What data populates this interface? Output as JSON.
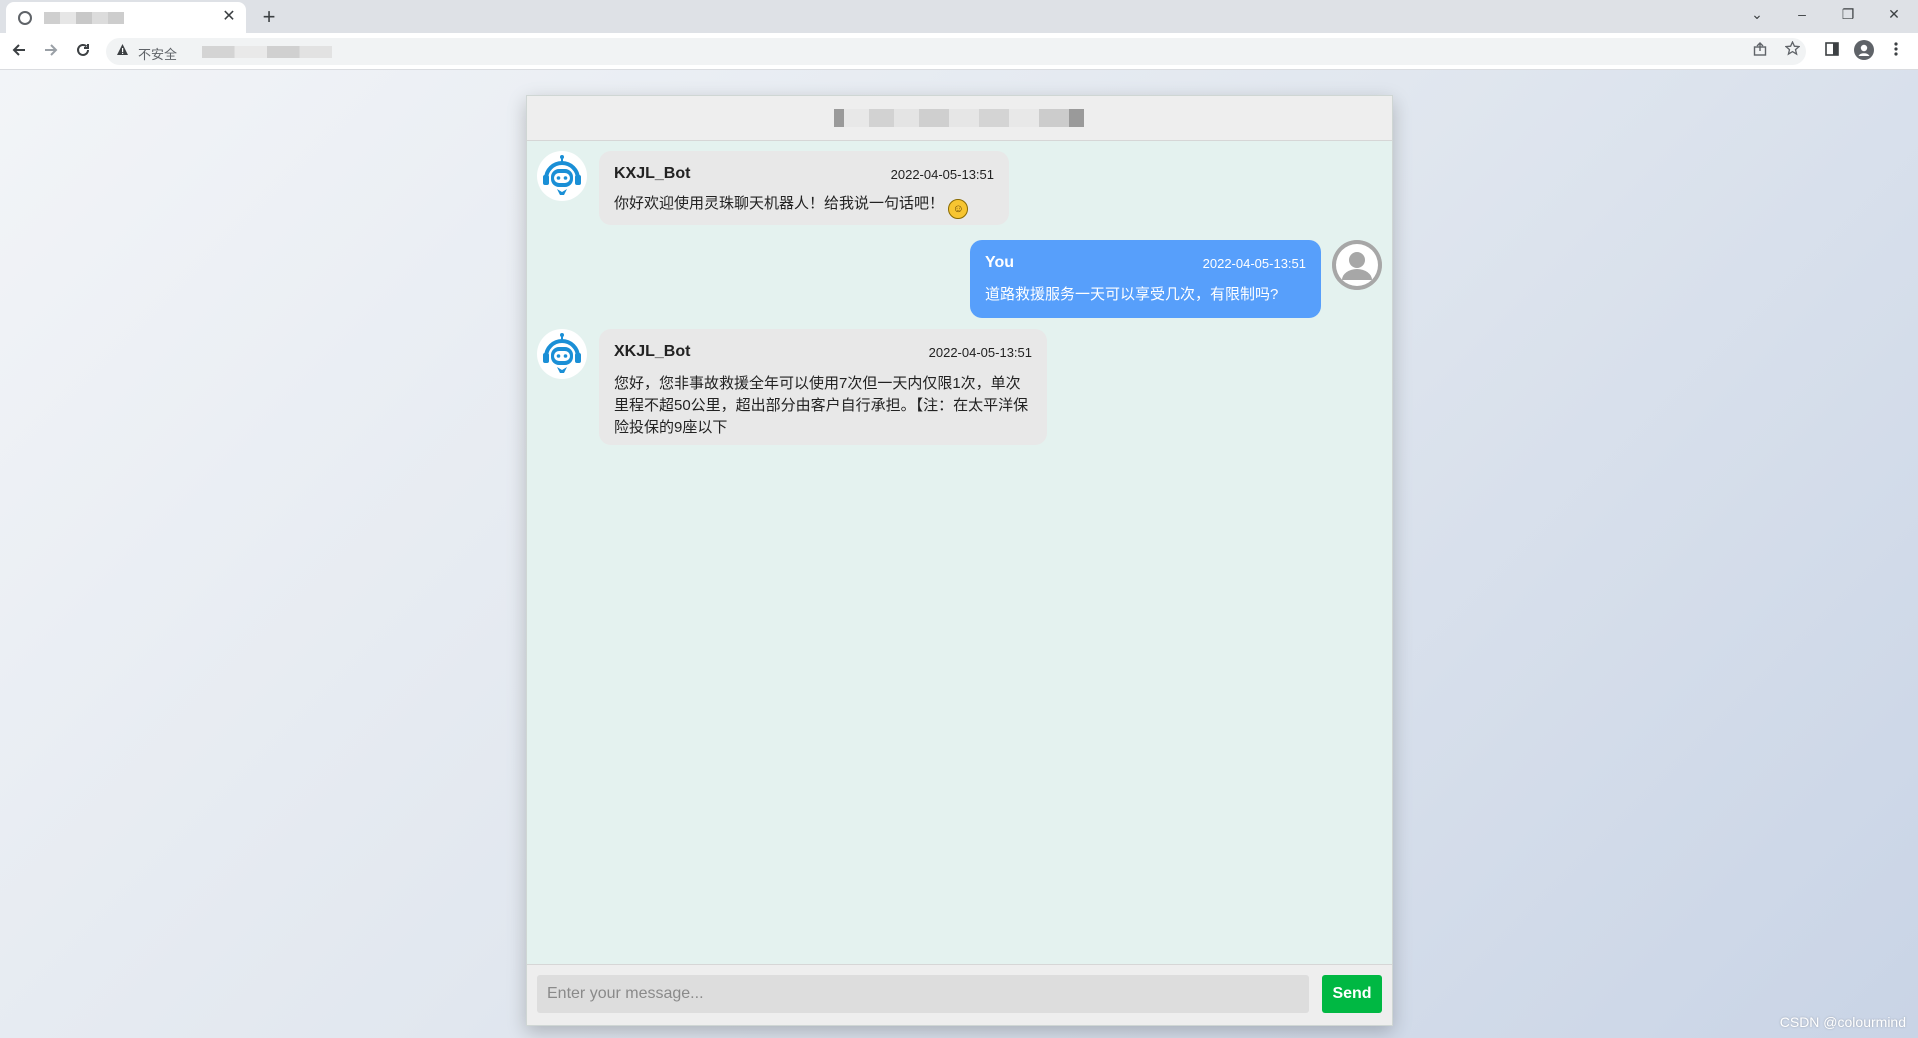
{
  "browser": {
    "tab_close": "✕",
    "new_tab": "+",
    "insecure_label": "不安全",
    "window_controls": [
      "⌄",
      "–",
      "❐",
      "✕"
    ]
  },
  "chat": {
    "messages": [
      {
        "sender": "KXJL_Bot",
        "time": "2022-04-05-13:51",
        "text": "你好欢迎使用灵珠聊天机器人！给我说一句话吧！"
      },
      {
        "sender": "You",
        "time": "2022-04-05-13:51",
        "text": "道路救援服务一天可以享受几次，有限制吗?"
      },
      {
        "sender": "XKJL_Bot",
        "time": "2022-04-05-13:51",
        "text": "您好，您非事故救援全年可以使用7次但一天内仅限1次，单次里程不超50公里，超出部分由客户自行承担。【注：在太平洋保险投保的9座以下"
      }
    ],
    "input_placeholder": "Enter your message...",
    "send_label": "Send"
  },
  "watermark": "CSDN @colourmind",
  "colors": {
    "user_bubble": "#579ffb",
    "bot_bubble": "#e8e8e8",
    "send_button": "#00b843",
    "chat_background": "#e4f2ef"
  }
}
